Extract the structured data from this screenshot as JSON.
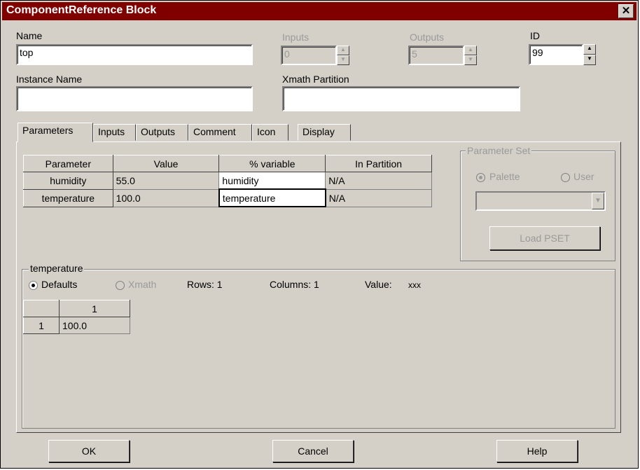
{
  "window": {
    "title": "ComponentReference Block",
    "close_glyph": "✕"
  },
  "fields": {
    "name": {
      "label": "Name",
      "value": "top"
    },
    "inputs": {
      "label": "Inputs",
      "value": "0"
    },
    "outputs": {
      "label": "Outputs",
      "value": "5"
    },
    "id": {
      "label": "ID",
      "value": "99"
    },
    "instance_name": {
      "label": "Instance Name",
      "value": ""
    },
    "xmath_partition": {
      "label": "Xmath Partition",
      "value": ""
    }
  },
  "tabs": [
    "Parameters",
    "Inputs",
    "Outputs",
    "Comment",
    "Icon",
    "Display"
  ],
  "param_table": {
    "headers": [
      "Parameter",
      "Value",
      "% variable",
      "In Partition"
    ],
    "rows": [
      [
        "humidity",
        "55.0",
        "humidity",
        "N/A"
      ],
      [
        "temperature",
        "100.0",
        "temperature",
        "N/A"
      ]
    ]
  },
  "parameter_set": {
    "title": "Parameter Set",
    "palette_label": "Palette",
    "user_label": "User",
    "load_label": "Load PSET"
  },
  "detail": {
    "title": "temperature",
    "defaults_label": "Defaults",
    "xmath_label": "Xmath",
    "rows_text": "Rows: 1",
    "columns_text": "Columns: 1",
    "value_label": "Value:",
    "value_text": "xxx",
    "col_header": "1",
    "row_header": "1",
    "cell_value": "100.0"
  },
  "buttons": {
    "ok": "OK",
    "cancel": "Cancel",
    "help": "Help"
  }
}
